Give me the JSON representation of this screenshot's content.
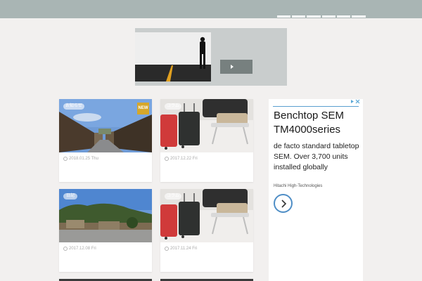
{
  "nav": {
    "items": [
      "menu-1",
      "menu-2",
      "menu-3",
      "menu-4",
      "menu-5",
      "menu-6"
    ]
  },
  "banner": {
    "button_icon": "play-triangle-icon"
  },
  "cards": [
    {
      "date": "2018.01.25 Thu",
      "category": "お知らせ",
      "badge": "NEW"
    },
    {
      "date": "2017.12.22 Fri",
      "category": "コラム"
    },
    {
      "date": "2017.12.08 Fri",
      "category": "日記"
    },
    {
      "date": "2017.11.24 Fri",
      "category": "コラム"
    }
  ],
  "ad": {
    "title": "Benchtop SEM TM4000series",
    "description": "de facto standard tabletop SEM. Over 3,700 units installed globally",
    "advertiser": "Hitachi High-Technologies",
    "choices_icon": "ad-choices-icon",
    "arrow_icon": "chevron-right-icon"
  },
  "colors": {
    "header": "#a9b5b4",
    "background": "#f2f0ef",
    "new_badge": "#d6a72a",
    "ad_accent": "#4f8ec6"
  }
}
